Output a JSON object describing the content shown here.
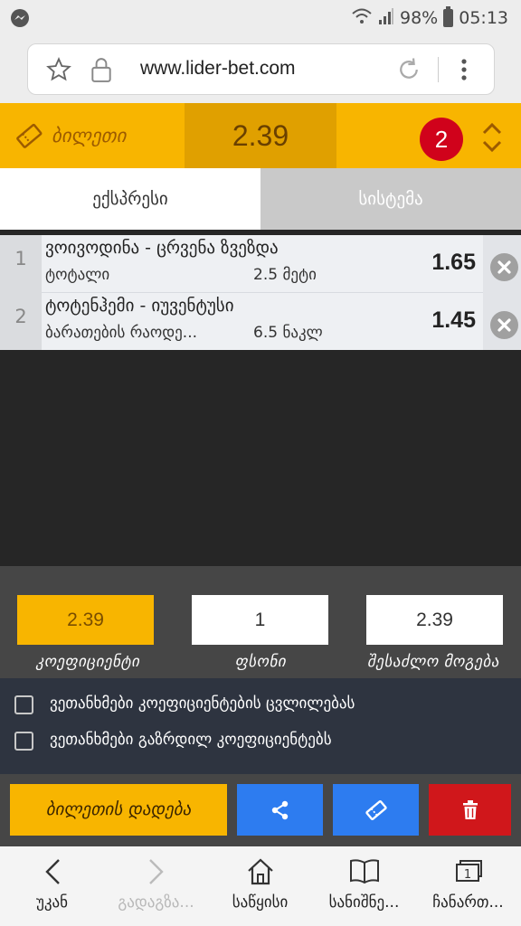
{
  "status_bar": {
    "battery": "98%",
    "time": "05:13"
  },
  "browser": {
    "url": "www.lider-bet.com"
  },
  "ticket_header": {
    "label": "ბილეთი",
    "total_odds": "2.39",
    "bet_count": "2"
  },
  "tabs": [
    {
      "label": "ექსპრესი",
      "active": true
    },
    {
      "label": "სისტემა",
      "active": false
    }
  ],
  "bets": [
    {
      "number": "1",
      "match": "ვოივოდინა - ცრვენა ზვეზდა",
      "market": "ტოტალი",
      "outcome": "2.5 მეტი",
      "odds": "1.65"
    },
    {
      "number": "2",
      "match": "ტოტენჰემი - იუვენტუსი",
      "market": "ბარათების რაოდე...",
      "outcome": "6.5 ნაკლ",
      "odds": "1.45"
    }
  ],
  "stake_panel": {
    "coefficient_value": "2.39",
    "coefficient_label": "კოეფიციენტი",
    "stake_value": "1",
    "stake_label": "ფსონი",
    "win_value": "2.39",
    "win_label": "შესაძლო მოგება"
  },
  "checkboxes": [
    {
      "label": "ვეთანხმები კოეფიციენტების ცვლილებას",
      "checked": false
    },
    {
      "label": "ვეთანხმები გაზრდილ კოეფიციენტებს",
      "checked": false
    }
  ],
  "actions": {
    "place_bet_label": "ბილეთის დადება"
  },
  "nav": [
    {
      "label": "უკან",
      "icon": "back-icon"
    },
    {
      "label": "გადაგზა...",
      "icon": "forward-icon"
    },
    {
      "label": "საწყისი",
      "icon": "home-icon"
    },
    {
      "label": "სანიშნე...",
      "icon": "bookmarks-icon"
    },
    {
      "label": "ჩანართ...",
      "icon": "tabs-icon"
    }
  ],
  "colors": {
    "accent": "#f8b500",
    "blue": "#2d7cf0",
    "red": "#d0171b"
  }
}
